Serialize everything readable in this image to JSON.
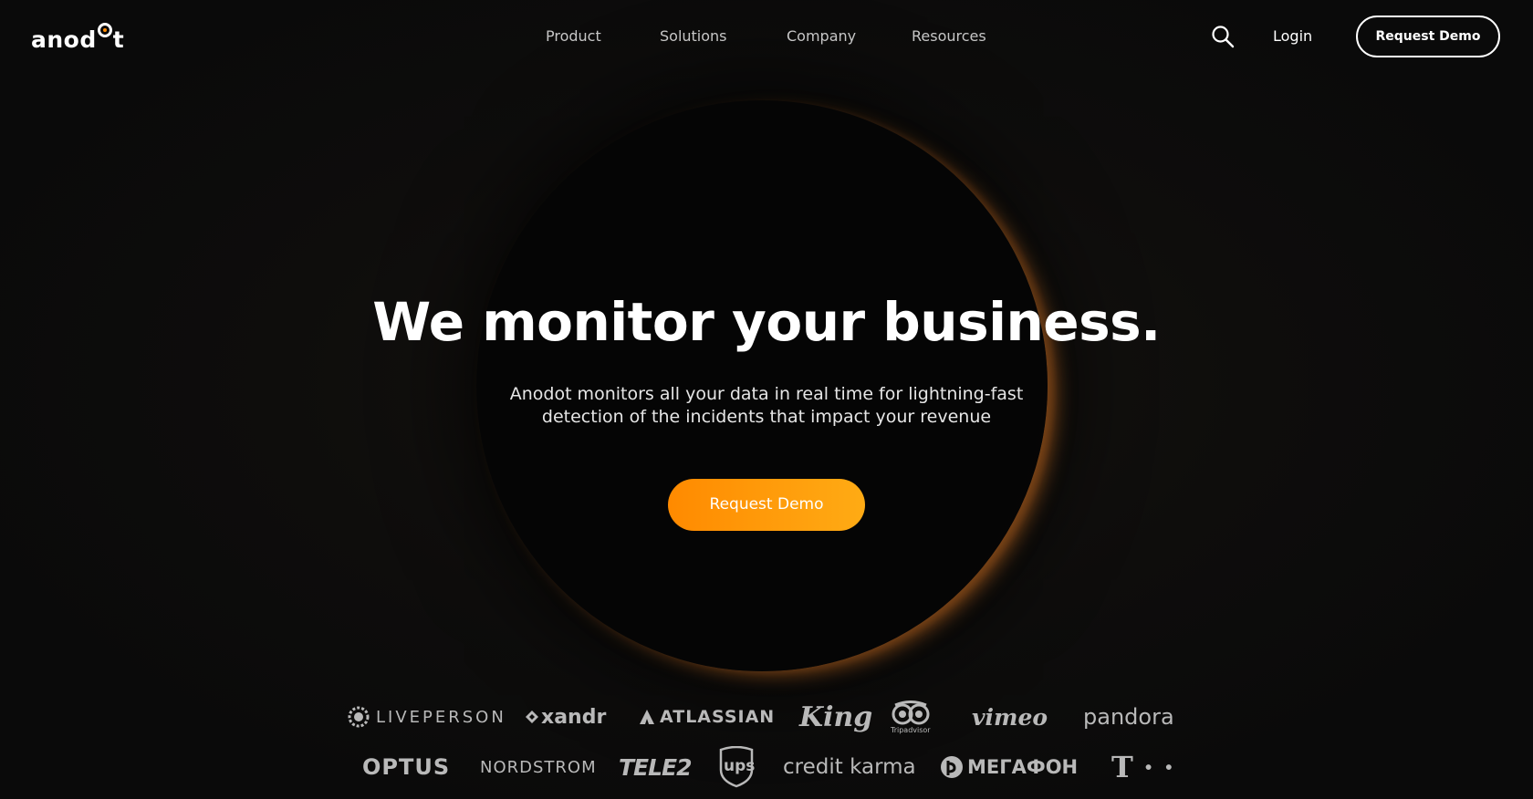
{
  "header": {
    "logo_text_1": "anod",
    "logo_text_2": "t",
    "nav": [
      "Product",
      "Solutions",
      "Company",
      "Resources"
    ],
    "login_label": "Login",
    "demo_label": "Request Demo",
    "search_icon": "search-icon"
  },
  "hero": {
    "title": "We monitor your business.",
    "subtitle_line1": "Anodot monitors all your data in real time for lightning-fast",
    "subtitle_line2": "detection of the incidents that impact your revenue",
    "cta_label": "Request Demo"
  },
  "logos": {
    "row1": [
      "LIVEPERSON",
      "xandr",
      "ATLASSIAN",
      "King",
      "Tripadvisor",
      "vimeo",
      "pandora"
    ],
    "row2": [
      "OPTUS",
      "NORDSTROM",
      "TELE2",
      "ups",
      "credit karma",
      "МЕГАФОН",
      "T · ·"
    ]
  },
  "colors": {
    "accent_orange": "#ff8a00",
    "background": "#0b0b0b",
    "logo_gray": "#b9b9b9"
  }
}
